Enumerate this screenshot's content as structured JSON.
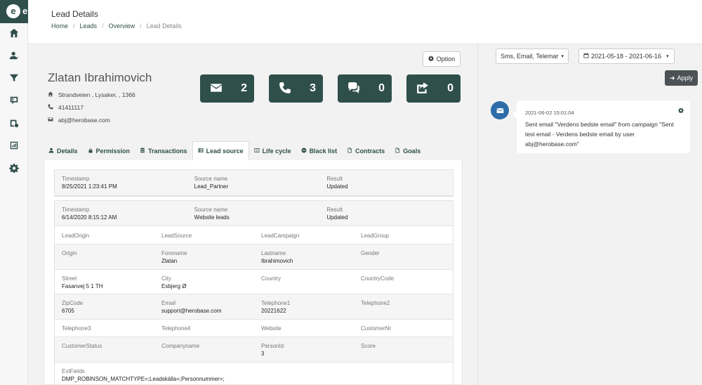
{
  "header": {
    "title": "Lead Details",
    "breadcrumb": [
      "Home",
      "Leads",
      "Overview",
      "Lead Details"
    ]
  },
  "lead": {
    "name": "Zlatan Ibrahimovich",
    "address": "Strandveien , Lysaker, , 1366",
    "phone": "41411117",
    "email": "abj@herobase.com",
    "option_label": "Option"
  },
  "stats": [
    {
      "icon": "envelope-icon",
      "value": "2"
    },
    {
      "icon": "phone-icon",
      "value": "3"
    },
    {
      "icon": "comments-icon",
      "value": "0"
    },
    {
      "icon": "share-icon",
      "value": "0"
    }
  ],
  "tabs": [
    {
      "label": "Details",
      "icon": "user-icon"
    },
    {
      "label": "Permission",
      "icon": "lock-icon"
    },
    {
      "label": "Transactions",
      "icon": "database-icon"
    },
    {
      "label": "Lead source",
      "icon": "list-icon",
      "active": true
    },
    {
      "label": "Life cycle",
      "icon": "columns-icon"
    },
    {
      "label": "Black list",
      "icon": "minus-circle-icon"
    },
    {
      "label": "Contracts",
      "icon": "file-icon"
    },
    {
      "label": "Goals",
      "icon": "file-icon"
    }
  ],
  "sources": [
    {
      "ts_label": "Timestamp",
      "ts": "8/25/2021 1:23:41 PM",
      "src_label": "Source name",
      "src": "Lead_Partner",
      "res_label": "Result",
      "res": "Updated"
    },
    {
      "ts_label": "Timestamp",
      "ts": "6/14/2020 8:15:12 AM",
      "src_label": "Source name",
      "src": "Website leads",
      "res_label": "Result",
      "res": "Updated"
    }
  ],
  "fields": {
    "r1": [
      {
        "l": "LeadOrigin",
        "v": ""
      },
      {
        "l": "LeadSource",
        "v": ""
      },
      {
        "l": "LeadCampaign",
        "v": ""
      },
      {
        "l": "LeadGroup",
        "v": ""
      }
    ],
    "r2": [
      {
        "l": "Origin",
        "v": ""
      },
      {
        "l": "Forename",
        "v": "Zlatan"
      },
      {
        "l": "Lastname",
        "v": "Ibrahimovich"
      },
      {
        "l": "Gender",
        "v": ""
      }
    ],
    "r3": [
      {
        "l": "Street",
        "v": "Fasanvej 5 1 TH"
      },
      {
        "l": "City",
        "v": "Esbjerg Ø"
      },
      {
        "l": "Country",
        "v": ""
      },
      {
        "l": "CountryCode",
        "v": ""
      }
    ],
    "r4": [
      {
        "l": "ZipCode",
        "v": "6705"
      },
      {
        "l": "Email",
        "v": "support@herobase.com"
      },
      {
        "l": "Telephone1",
        "v": "20221622"
      },
      {
        "l": "Telephone2",
        "v": ""
      }
    ],
    "r5": [
      {
        "l": "Telephone3",
        "v": ""
      },
      {
        "l": "Telephone4",
        "v": ""
      },
      {
        "l": "Website",
        "v": ""
      },
      {
        "l": "CustomerNr",
        "v": ""
      }
    ],
    "r6": [
      {
        "l": "CustomerStatus",
        "v": ""
      },
      {
        "l": "Companyname",
        "v": ""
      },
      {
        "l": "PersonId",
        "v": "3"
      },
      {
        "l": "Score",
        "v": ""
      }
    ],
    "ext": {
      "l": "ExtFields",
      "v": "DMP_ROBINSON_MATCHTYPE=;Leadskälla=;Personnummer=;"
    }
  },
  "right": {
    "channel_select": "Sms, Email, Telemarket",
    "date_range": "2021-05-18 - 2021-06-16",
    "apply_label": "Apply",
    "timeline": [
      {
        "time": "2021-06-02 15:01:04",
        "text": "Sent email \"Verdens bedste email\" from campaign \"Sent test email - Verdens bedste email by user abj@herobase.com\""
      }
    ]
  },
  "colors": {
    "primary": "#2f4f4b",
    "timeline_dot": "#2d6ca8",
    "apply_button": "#4c5255"
  }
}
